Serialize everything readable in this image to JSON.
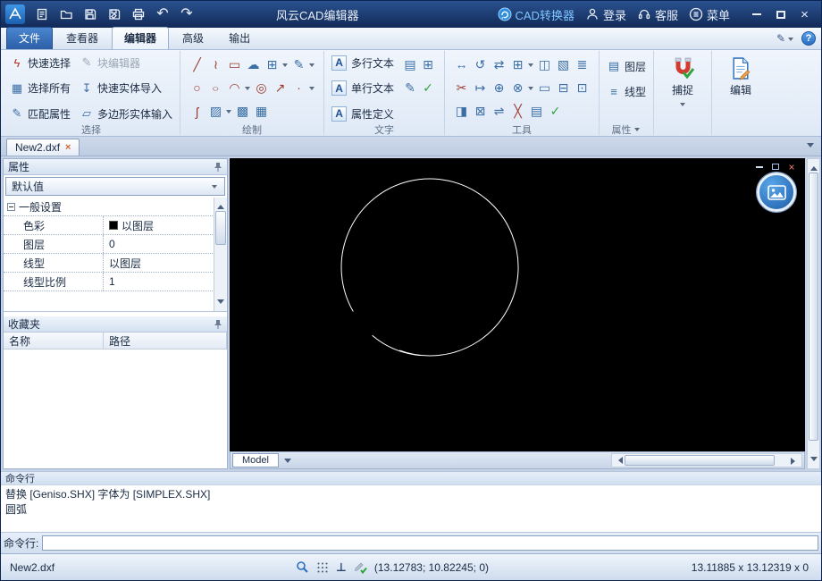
{
  "window": {
    "title": "风云CAD编辑器",
    "right_actions": {
      "cad_converter": "CAD转换器",
      "login": "登录",
      "service": "客服",
      "menu": "菜单"
    }
  },
  "glyphs": {
    "undo": "↶",
    "redo": "↷",
    "close": "×",
    "pencil": "✎",
    "help": "?"
  },
  "ribbon": {
    "tabs": [
      {
        "label": "文件"
      },
      {
        "label": "查看器"
      },
      {
        "label": "编辑器"
      },
      {
        "label": "高级"
      },
      {
        "label": "输出"
      }
    ],
    "groups": {
      "select": {
        "label": "选择",
        "items": [
          {
            "label": "快速选择",
            "glyph": "ϟ"
          },
          {
            "label": "块编辑器",
            "glyph": "✎"
          },
          {
            "label": "选择所有",
            "glyph": "▦"
          },
          {
            "label": "快速实体导入",
            "glyph": "↧"
          },
          {
            "label": "匹配属性",
            "glyph": "✎"
          },
          {
            "label": "多边形实体输入",
            "glyph": "▱"
          }
        ]
      },
      "draw": {
        "label": "绘制",
        "icons": [
          {
            "name": "line",
            "glyph": "╱"
          },
          {
            "name": "polyline",
            "glyph": "≀"
          },
          {
            "name": "rectangle",
            "glyph": "▭"
          },
          {
            "name": "revision-cloud",
            "glyph": "☁"
          },
          {
            "name": "region",
            "glyph": "⊞"
          },
          {
            "name": "sketch",
            "glyph": "✎"
          },
          {
            "name": "circle",
            "glyph": "○"
          },
          {
            "name": "ellipse",
            "glyph": "○"
          },
          {
            "name": "arc",
            "glyph": "◠"
          },
          {
            "name": "donut",
            "glyph": "◎"
          },
          {
            "name": "ray",
            "glyph": "↗"
          },
          {
            "name": "point",
            "glyph": "∙"
          },
          {
            "name": "spline",
            "glyph": "ʃ"
          },
          {
            "name": "hatch",
            "glyph": "▨"
          },
          {
            "name": "gradient",
            "glyph": "▩"
          },
          {
            "name": "table",
            "glyph": "▦"
          }
        ]
      },
      "text": {
        "label": "文字",
        "items": [
          {
            "label": "多行文本",
            "glyph": "A"
          },
          {
            "label": "单行文本",
            "glyph": "A"
          },
          {
            "label": "属性定义",
            "glyph": "A"
          }
        ],
        "side_icons": [
          {
            "name": "text-style",
            "glyph": "▤"
          },
          {
            "name": "field",
            "glyph": "⊞"
          },
          {
            "name": "edit-text",
            "glyph": "✎"
          },
          {
            "name": "check-spelling",
            "glyph": "✓"
          }
        ]
      },
      "tools": {
        "label": "工具",
        "icons": [
          {
            "name": "move",
            "glyph": "↔"
          },
          {
            "name": "rotate",
            "glyph": "↺"
          },
          {
            "name": "mirror",
            "glyph": "⇄"
          },
          {
            "name": "array",
            "glyph": "⊞"
          },
          {
            "name": "copy",
            "glyph": "◫"
          },
          {
            "name": "scale",
            "glyph": "▧"
          },
          {
            "name": "list",
            "glyph": "≣"
          },
          {
            "name": "trim",
            "glyph": "✂"
          },
          {
            "name": "extend",
            "glyph": "↦"
          },
          {
            "name": "offset",
            "glyph": "⊕"
          },
          {
            "name": "explode",
            "glyph": "⊗"
          },
          {
            "name": "stretch",
            "glyph": "▭"
          },
          {
            "name": "erase",
            "glyph": "⊟"
          },
          {
            "name": "fillet",
            "glyph": "⊡"
          },
          {
            "name": "chamfer",
            "glyph": "◨"
          },
          {
            "name": "break",
            "glyph": "⊠"
          },
          {
            "name": "join",
            "glyph": "⇌"
          },
          {
            "name": "measure",
            "glyph": "╳"
          },
          {
            "name": "group",
            "glyph": "▤"
          },
          {
            "name": "check",
            "glyph": "✓"
          }
        ]
      },
      "props": {
        "label": "属性",
        "items": [
          {
            "label": "图层",
            "glyph": "▤"
          },
          {
            "label": "线型",
            "glyph": "≡"
          }
        ]
      },
      "snap": {
        "label": "捕捉"
      },
      "edit": {
        "label": "编辑"
      }
    }
  },
  "doc_tabs": {
    "tabs": [
      {
        "label": "New2.dxf"
      }
    ],
    "close_glyph": "×"
  },
  "properties_panel": {
    "title": "属性",
    "preset": "默认值",
    "tree_header": "一般设置",
    "rows": [
      {
        "label": "色彩",
        "value": "以图层"
      },
      {
        "label": "图层",
        "value": "0"
      },
      {
        "label": "线型",
        "value": "以图层"
      },
      {
        "label": "线型比例",
        "value": "1"
      }
    ]
  },
  "favorites_panel": {
    "title": "收藏夹",
    "columns": [
      {
        "label": "名称"
      },
      {
        "label": "路径"
      }
    ]
  },
  "canvas": {
    "model_tab": "Model"
  },
  "command_panel": {
    "title": "命令行",
    "lines": [
      {
        "text": "替换 [Geniso.SHX] 字体为 [SIMPLEX.SHX]"
      },
      {
        "text": "圆弧"
      }
    ],
    "prompt_label": "命令行:",
    "input_value": ""
  },
  "status_bar": {
    "file": "New2.dxf",
    "perp_glyph": "⊥",
    "coords": "(13.12783; 10.82245; 0)",
    "extent": "13.11885 x 13.12319 x 0"
  },
  "colors": {
    "titlebar": "#16305e",
    "accent": "#2a7fd4",
    "canvas_bg": "#000000",
    "arc_stroke": "#ffffff"
  }
}
